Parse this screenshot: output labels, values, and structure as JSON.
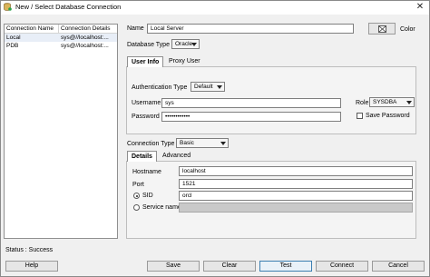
{
  "window": {
    "title": "New / Select Database Connection",
    "close_glyph": "✕"
  },
  "list": {
    "headers": [
      "Connection Name",
      "Connection Details"
    ],
    "rows": [
      {
        "name": "Local",
        "details": "sys@//localhost:..."
      },
      {
        "name": "PDB",
        "details": "sys@//localhost:..."
      }
    ]
  },
  "form": {
    "name_label": "Name",
    "name_value": "Local Server",
    "color_label": "Color",
    "db_type_label": "Database Type",
    "db_type_value": "Oracle",
    "tabs": [
      "User Info",
      "Proxy User"
    ],
    "auth_type_label": "Authentication Type",
    "auth_type_value": "Default",
    "username_label": "Username",
    "username_value": "sys",
    "role_label": "Role",
    "role_value": "SYSDBA",
    "password_label": "Password",
    "password_value": "••••••••••••",
    "save_password_label": "Save Password",
    "conn_type_label": "Connection Type",
    "conn_type_value": "Basic",
    "detail_tabs": [
      "Details",
      "Advanced"
    ],
    "hostname_label": "Hostname",
    "hostname_value": "localhost",
    "port_label": "Port",
    "port_value": "1521",
    "sid_label": "SID",
    "sid_value": "orcl",
    "service_label": "Service name",
    "service_value": ""
  },
  "status": "Status : Success",
  "buttons": {
    "help": "Help",
    "save": "Save",
    "clear": "Clear",
    "test": "Test",
    "connect": "Connect",
    "cancel": "Cancel"
  }
}
